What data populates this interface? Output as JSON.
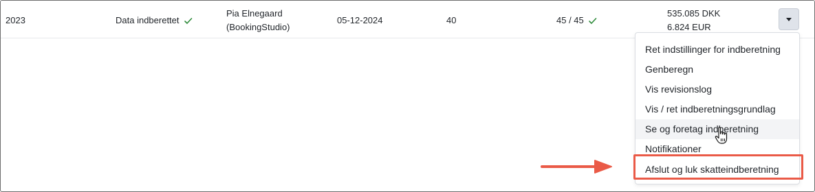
{
  "row": {
    "year": "2023",
    "status": "Data indberettet",
    "status_icon": "check-icon",
    "user_line1": "Pia Elnegaard",
    "user_line2": "(BookingStudio)",
    "date": "05-12-2024",
    "count": "40",
    "ratio": "45 / 45",
    "ratio_icon": "check-icon",
    "amount_dkk": "535.085 DKK",
    "amount_eur": "6.824 EUR"
  },
  "menu": {
    "toggle_icon": "caret-down-icon",
    "items": [
      {
        "label": "Ret indstillinger for indberetning"
      },
      {
        "label": "Genberegn"
      },
      {
        "label": "Vis revisionslog"
      },
      {
        "label": "Vis / ret indberetningsgrundlag"
      },
      {
        "label": "Se og foretag indberetning"
      },
      {
        "label": "Notifikationer"
      },
      {
        "label": "Afslut og luk skatteindberetning"
      }
    ]
  },
  "colors": {
    "check_green": "#2e8b3a",
    "highlight_red": "#ea5a47",
    "toggle_bg": "#dfe3ea"
  }
}
